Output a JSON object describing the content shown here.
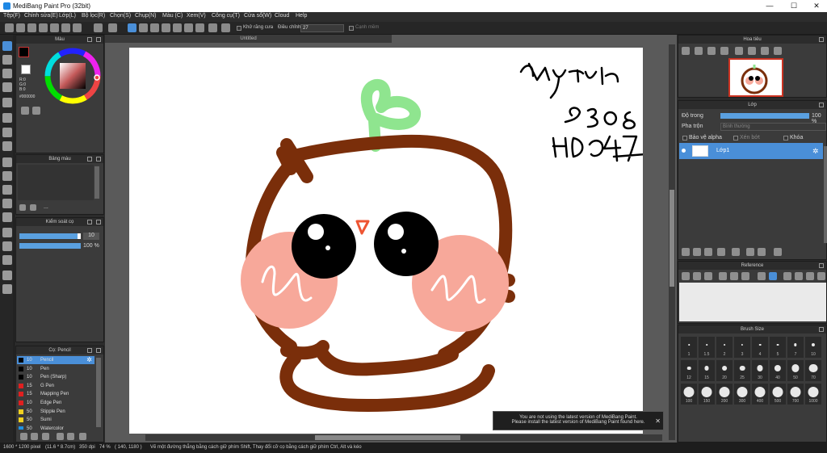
{
  "window": {
    "title": "MediBang Paint Pro (32bit)",
    "controls": {
      "minimize": "—",
      "maximize": "☐",
      "close": "✕"
    }
  },
  "menu": [
    "Tệp(F)",
    "Chỉnh sửa(E)",
    "Lớp(L)",
    "Bộ lọc(R)",
    "Chọn(S)",
    "Chụp(N)",
    "Màu (C)",
    "Xem(V)",
    "Công cụ(T)",
    "Cửa sổ(W)",
    "Cloud",
    "Help"
  ],
  "toolbar": {
    "antialias_label": "Khử răng cưa",
    "adjust_label": "Điều chỉnh",
    "adjust_value": "27",
    "smooth_label": "Cạnh mềm"
  },
  "document": {
    "tab_title": "Untitled"
  },
  "color_panel": {
    "title": "Màu",
    "r": "R:0",
    "g": "G:0",
    "b": "B:0",
    "hex": "#000000"
  },
  "palette_panel": {
    "title": "Bảng màu",
    "dots": "..."
  },
  "brush_control": {
    "title": "Kiểm soát cọ",
    "size_value": "10",
    "opacity_value": "100 %",
    "size_fill": 0.95,
    "opacity_fill": 1.0
  },
  "brush_panel": {
    "title": "Cọ: Pencil",
    "items": [
      {
        "size": "10",
        "name": "Pencil",
        "color": "#000000",
        "selected": true
      },
      {
        "size": "10",
        "name": "Pen",
        "color": "#000000"
      },
      {
        "size": "10",
        "name": "Pen (Sharp)",
        "color": "#000000"
      },
      {
        "size": "15",
        "name": "G Pen",
        "color": "#e02020"
      },
      {
        "size": "15",
        "name": "Mapping Pen",
        "color": "#e02020"
      },
      {
        "size": "10",
        "name": "Edge Pen",
        "color": "#e02020"
      },
      {
        "size": "50",
        "name": "Stipple Pen",
        "color": "#f0d020"
      },
      {
        "size": "50",
        "name": "Sumi",
        "color": "#f0d020"
      },
      {
        "size": "50",
        "name": "Watercolor",
        "color": "#2090e0"
      }
    ]
  },
  "navigator": {
    "title": "Hoa tiêu"
  },
  "layer_panel": {
    "title": "Lớp",
    "opacity_label": "Độ trong",
    "opacity_value": "100 %",
    "opacity_fill": 1.0,
    "blend_label": "Pha trộn",
    "blend_value": "Bình thường",
    "protect_alpha": "Bảo vệ alpha",
    "clipping": "Xén bớt",
    "lock": "Khóa",
    "layer_name": "Lớp1"
  },
  "reference_panel": {
    "title": "Reference"
  },
  "brush_size_panel": {
    "title": "Brush Size",
    "sizes": [
      "1",
      "1.5",
      "2",
      "3",
      "4",
      "5",
      "7",
      "10",
      "12",
      "15",
      "20",
      "25",
      "30",
      "40",
      "50",
      "70",
      "100",
      "150",
      "200",
      "300",
      "400",
      "500",
      "700",
      "1000"
    ]
  },
  "update_notice": {
    "line1": "You are not using the latest version of MediBang Paint.",
    "line2": "Please install the latest version of MediBang Paint found here.",
    "close": "✕"
  },
  "status": {
    "dimensions": "1600 * 1200 pixel",
    "physical": "(11.6 * 8.7cm)",
    "dpi": "350 dpi",
    "zoom": "74 %",
    "coords": "( 140, 1180 )",
    "hint": "Vẽ một đường thẳng bằng cách giữ phím Shift, Thay đổi cỡ cọ bằng cách giữ phím Ctrl, Alt và kéo"
  },
  "colors": {
    "accent": "#4a8fd8",
    "stroke": "#7a2e0a",
    "cheek": "#f7a89a",
    "sprout": "#8fe58f"
  }
}
